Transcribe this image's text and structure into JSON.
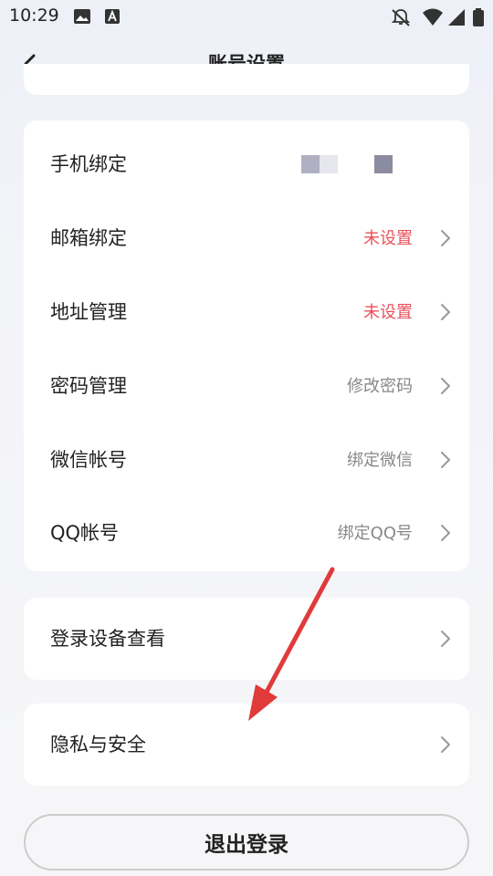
{
  "status_bar": {
    "time": "10:29"
  },
  "header": {
    "title": "账号设置"
  },
  "account_rows": [
    {
      "label": "手机绑定",
      "value": ""
    },
    {
      "label": "邮箱绑定",
      "value": "未设置"
    },
    {
      "label": "地址管理",
      "value": "未设置"
    },
    {
      "label": "密码管理",
      "value": "修改密码"
    },
    {
      "label": "微信帐号",
      "value": "绑定微信"
    },
    {
      "label": "QQ帐号",
      "value": "绑定QQ号"
    }
  ],
  "device_row": {
    "label": "登录设备查看"
  },
  "privacy_row": {
    "label": "隐私与安全"
  },
  "logout_button": {
    "label": "退出登录"
  },
  "colors": {
    "warning_value": "#e8505b",
    "annotation_arrow": "#e03a3a"
  }
}
